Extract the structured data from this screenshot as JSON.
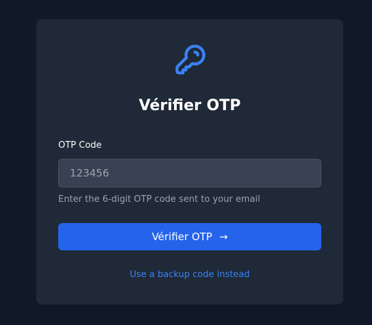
{
  "header": {
    "icon": "key-icon",
    "title": "Vérifier OTP"
  },
  "form": {
    "otp_label": "OTP Code",
    "otp_value": "",
    "otp_placeholder": "123456",
    "help_text": "Enter the 6-digit OTP code sent to your email",
    "submit_label": "Vérifier OTP",
    "submit_icon": "arrow-right-icon"
  },
  "footer": {
    "backup_link": "Use a backup code instead"
  },
  "colors": {
    "background": "#111827",
    "card": "#1f2937",
    "accent": "#2563eb",
    "link": "#3b82f6",
    "icon": "#3b82f6"
  }
}
